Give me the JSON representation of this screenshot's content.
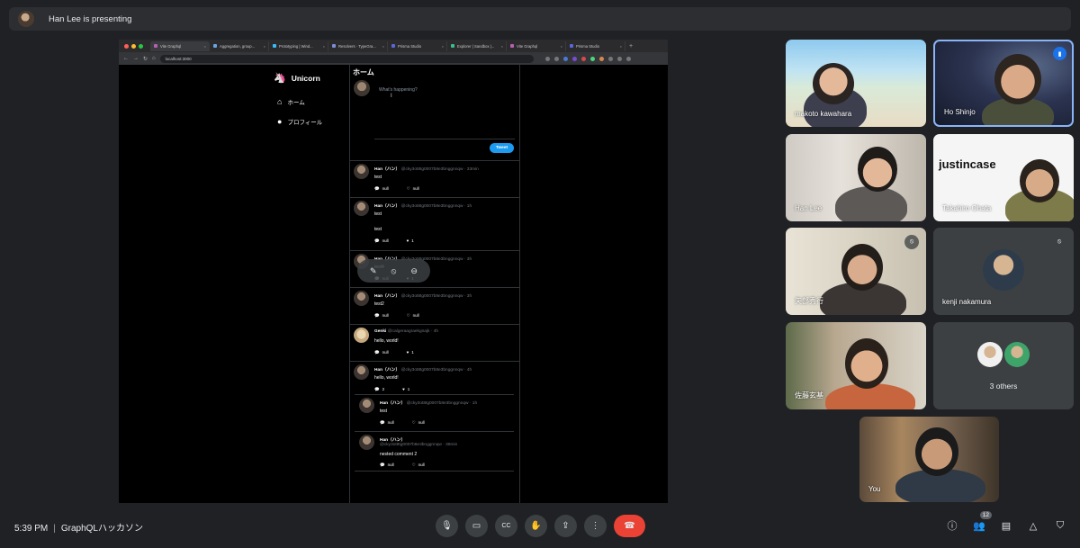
{
  "presenting": {
    "label": "Han Lee is presenting"
  },
  "browser": {
    "tabs": [
      "Vite Graphql",
      "Aggregation, group...",
      "Prototyping | Wind...",
      "Resolvers · TypeGra...",
      "Prisma Studio",
      "Explorer | Sandbox |...",
      "Vite Graphql",
      "Prisma Studio"
    ],
    "url": "localhost:3000"
  },
  "app": {
    "brand": "Unicorn",
    "nav": [
      {
        "label": "ホーム",
        "icon": "home-icon"
      },
      {
        "label": "プロフィール",
        "icon": "profile-icon"
      }
    ],
    "title": "ホーム",
    "compose_placeholder": "What's happening?",
    "tweet_button": "Tweet",
    "posts": [
      {
        "name": "Han（ハン）",
        "handle": "@cky3ot8tg0007b8e3bnggnnqw",
        "time": "· 33min",
        "text": "test",
        "text2": "",
        "comments": "null",
        "likes": "null"
      },
      {
        "name": "Han（ハン）",
        "handle": "@cky3ot8tg0007b8e3bnggnnqw",
        "time": "· 1h",
        "text": "test",
        "text2": "test",
        "comments": "null",
        "likes": "1"
      },
      {
        "name": "Han（ハン）",
        "handle": "@cky3ot8tg0007b8e3bnggnnqw",
        "time": "· 3h",
        "text": "test4",
        "text2": "",
        "comments": "null",
        "likes": "1"
      },
      {
        "name": "Han（ハン）",
        "handle": "@cky3ot8tg0007b8e3bnggnnqw",
        "time": "· 3h",
        "text": "test2",
        "text2": "",
        "comments": "null",
        "likes": "null"
      },
      {
        "name": "Genki",
        "handle": "@calgeraagraekgnajk",
        "time": "· 4h",
        "text": "hello, world!",
        "text2": "",
        "comments": "null",
        "likes": "1"
      },
      {
        "name": "Han（ハン）",
        "handle": "@cky3ot8tg0007b8e3bnggnnqw",
        "time": "· 4h",
        "text": "hello, world!",
        "text2": "",
        "comments": "2",
        "likes": "1"
      }
    ],
    "replies": [
      {
        "name": "Han（ハン）",
        "handle": "@cky3ot8tg0007b8e3bnggnnqw",
        "time": "· 1h",
        "text": "test",
        "comments": "null",
        "likes": "null"
      },
      {
        "name": "Han（ハン）",
        "handle": "@cky3ot8tg0007b8e3bnggnnqw · 38min",
        "time": "",
        "text": "nested comment 2",
        "comments": "null",
        "likes": "null"
      }
    ]
  },
  "participants": [
    {
      "name": "makoto kawahara",
      "muted": false,
      "speaking": false
    },
    {
      "name": "Ho Shinjo",
      "muted": false,
      "speaking": true
    },
    {
      "name": "Han Lee",
      "muted": false,
      "speaking": false
    },
    {
      "name": "Takahiro Ohata",
      "muted": false,
      "speaking": false
    },
    {
      "name": "矢部秀行",
      "muted": true,
      "speaking": false
    },
    {
      "name": "kenji nakamura",
      "muted": true,
      "speaking": false
    },
    {
      "name": "佐藤玄基",
      "muted": false,
      "speaking": false
    },
    {
      "name": "3 others",
      "muted": false,
      "speaking": false
    },
    {
      "name": "You",
      "muted": false,
      "speaking": false
    }
  ],
  "justincase_logo": "justincase",
  "bottom": {
    "time": "5:39 PM",
    "separator": "|",
    "meeting": "GraphQLハッカソン",
    "people_count": "12"
  }
}
